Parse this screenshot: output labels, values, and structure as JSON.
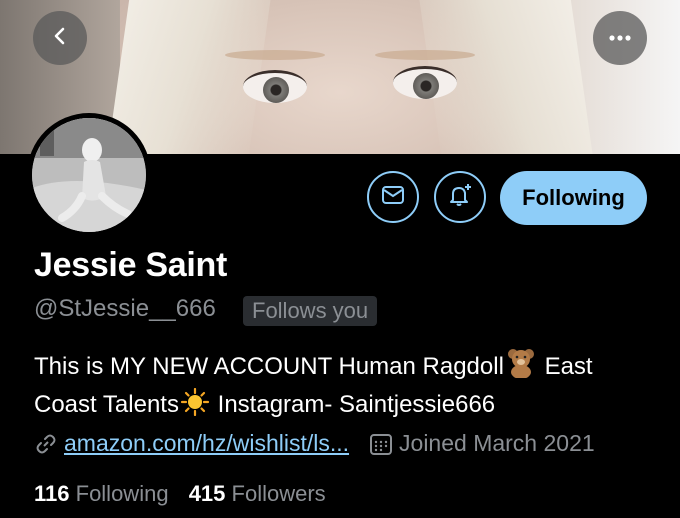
{
  "profile": {
    "name": "Jessie Saint",
    "handle": "@StJessie__666",
    "follows_you": "Follows you",
    "bio_line1": "This is MY NEW ACCOUNT Human Ragdoll",
    "bio_line1_tail": "East",
    "bio_line2": "Coast Talents",
    "bio_line2_tail": "Instagram- Saintjessie666",
    "website": "amazon.com/hz/wishlist/ls...",
    "joined": "Joined March 2021",
    "following_count": "116",
    "following_label": "Following",
    "followers_count": "415",
    "followers_label": "Followers"
  },
  "actions": {
    "follow_state": "Following"
  },
  "icons": {
    "back": "chevron-left-icon",
    "more": "more-horizontal-icon",
    "message": "mail-icon",
    "notify": "bell-plus-icon",
    "link": "link-icon",
    "calendar": "calendar-icon",
    "bear": "teddy-bear-emoji",
    "sun": "sun-emoji"
  },
  "colors": {
    "accent": "#8ecdf8",
    "muted": "#8b8f94",
    "background": "#000000"
  }
}
